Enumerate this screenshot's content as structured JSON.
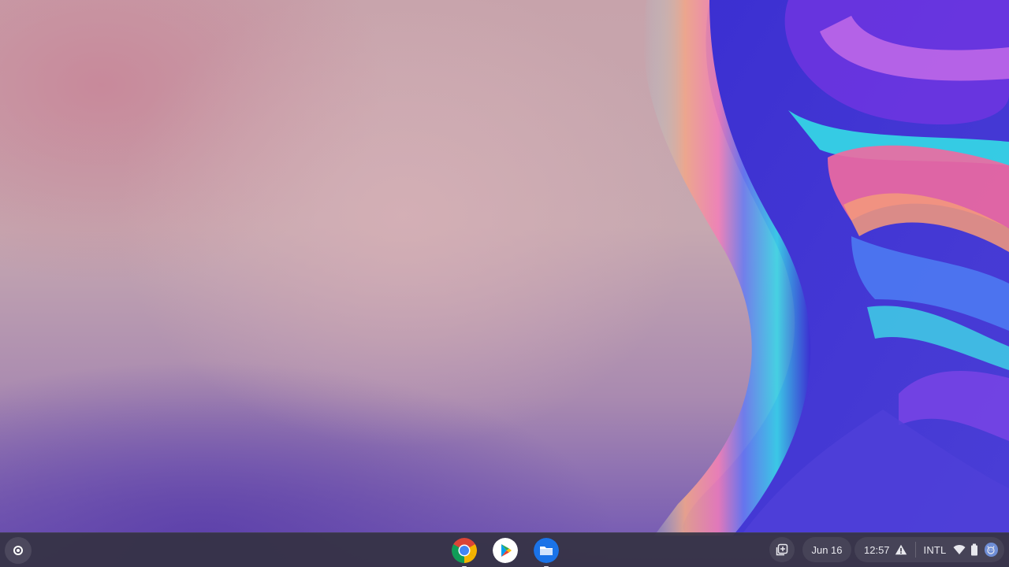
{
  "shelf": {
    "apps": [
      {
        "name": "Chrome",
        "icon": "chrome-icon",
        "running": true
      },
      {
        "name": "Play Store",
        "icon": "play-store-icon",
        "running": false
      },
      {
        "name": "Files",
        "icon": "files-icon",
        "running": true
      }
    ]
  },
  "tray": {
    "date": "Jun 16",
    "time": "12:57",
    "ime": "INTL",
    "icons": [
      "holding-space-icon",
      "warning-icon",
      "wifi-icon",
      "battery-icon",
      "avatar-icon"
    ]
  },
  "colors": {
    "shelf_bg": "#343242",
    "tray_text": "#e8e8ee",
    "chrome_red": "#db4437",
    "chrome_yellow": "#f4b400",
    "chrome_green": "#0f9d58",
    "chrome_blue": "#4285f4",
    "files_blue": "#1a73e8"
  }
}
